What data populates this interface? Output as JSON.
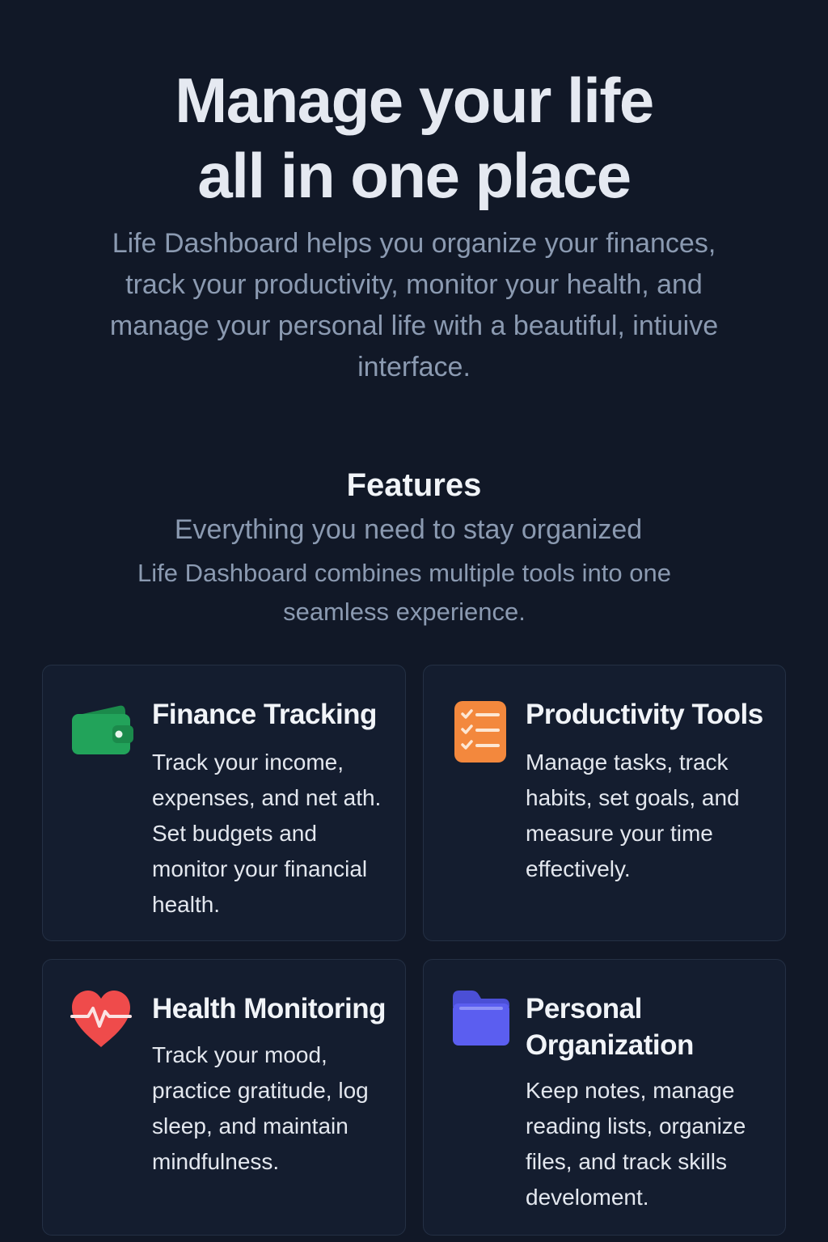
{
  "hero": {
    "title_line1": "Manage your life",
    "title_line2": "all in one place",
    "subtitle": "Life Dashboard helps you organize your finances, track your productivity, monitor your health, and manage your personal life with a beautiful, intiuive interface."
  },
  "features": {
    "heading": "Features",
    "tagline": "Everything you need to stay organized",
    "description": "Life Dashboard combines multiple tools into one seamless experience.",
    "cards": [
      {
        "icon": "wallet-icon",
        "icon_color": "#22a35a",
        "title": "Finance Tracking",
        "description": "Track your income, expenses, and net ath. Set budgets and monitor your financial health."
      },
      {
        "icon": "checklist-icon",
        "icon_color": "#f3883d",
        "title": "Productivity Tools",
        "description": "Manage tasks, track habits, set goals, and measure your time effectively."
      },
      {
        "icon": "heart-pulse-icon",
        "icon_color": "#ef4b4b",
        "title": "Health Monitoring",
        "description": "Track your mood, practice gratitude, log sleep, and maintain mindfulness."
      },
      {
        "icon": "folder-icon",
        "icon_color": "#5b5ef0",
        "title": "Personal Organization",
        "description": "Keep notes, manage reading lists, organize files, and track skills develoment."
      }
    ]
  }
}
